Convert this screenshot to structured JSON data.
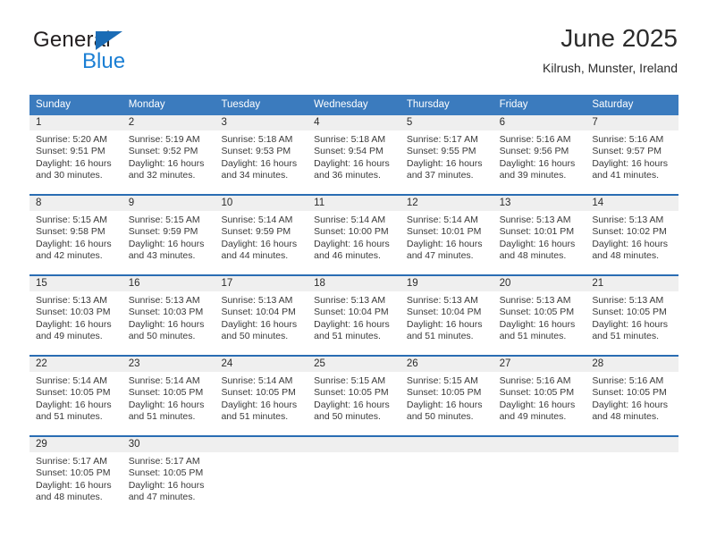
{
  "brand": {
    "name_part1": "General",
    "name_part2": "Blue",
    "accent_color": "#1b7fd4",
    "triangle_color": "#1b6cb5"
  },
  "header": {
    "title": "June 2025",
    "location": "Kilrush, Munster, Ireland"
  },
  "calendar": {
    "header_bg": "#3b7bbe",
    "header_text_color": "#ffffff",
    "row_divider_color": "#2a6db3",
    "day_band_bg": "#efefef",
    "weekdays": [
      "Sunday",
      "Monday",
      "Tuesday",
      "Wednesday",
      "Thursday",
      "Friday",
      "Saturday"
    ],
    "weeks": [
      [
        {
          "day": "1",
          "sunrise": "Sunrise: 5:20 AM",
          "sunset": "Sunset: 9:51 PM",
          "daylight": "Daylight: 16 hours and 30 minutes."
        },
        {
          "day": "2",
          "sunrise": "Sunrise: 5:19 AM",
          "sunset": "Sunset: 9:52 PM",
          "daylight": "Daylight: 16 hours and 32 minutes."
        },
        {
          "day": "3",
          "sunrise": "Sunrise: 5:18 AM",
          "sunset": "Sunset: 9:53 PM",
          "daylight": "Daylight: 16 hours and 34 minutes."
        },
        {
          "day": "4",
          "sunrise": "Sunrise: 5:18 AM",
          "sunset": "Sunset: 9:54 PM",
          "daylight": "Daylight: 16 hours and 36 minutes."
        },
        {
          "day": "5",
          "sunrise": "Sunrise: 5:17 AM",
          "sunset": "Sunset: 9:55 PM",
          "daylight": "Daylight: 16 hours and 37 minutes."
        },
        {
          "day": "6",
          "sunrise": "Sunrise: 5:16 AM",
          "sunset": "Sunset: 9:56 PM",
          "daylight": "Daylight: 16 hours and 39 minutes."
        },
        {
          "day": "7",
          "sunrise": "Sunrise: 5:16 AM",
          "sunset": "Sunset: 9:57 PM",
          "daylight": "Daylight: 16 hours and 41 minutes."
        }
      ],
      [
        {
          "day": "8",
          "sunrise": "Sunrise: 5:15 AM",
          "sunset": "Sunset: 9:58 PM",
          "daylight": "Daylight: 16 hours and 42 minutes."
        },
        {
          "day": "9",
          "sunrise": "Sunrise: 5:15 AM",
          "sunset": "Sunset: 9:59 PM",
          "daylight": "Daylight: 16 hours and 43 minutes."
        },
        {
          "day": "10",
          "sunrise": "Sunrise: 5:14 AM",
          "sunset": "Sunset: 9:59 PM",
          "daylight": "Daylight: 16 hours and 44 minutes."
        },
        {
          "day": "11",
          "sunrise": "Sunrise: 5:14 AM",
          "sunset": "Sunset: 10:00 PM",
          "daylight": "Daylight: 16 hours and 46 minutes."
        },
        {
          "day": "12",
          "sunrise": "Sunrise: 5:14 AM",
          "sunset": "Sunset: 10:01 PM",
          "daylight": "Daylight: 16 hours and 47 minutes."
        },
        {
          "day": "13",
          "sunrise": "Sunrise: 5:13 AM",
          "sunset": "Sunset: 10:01 PM",
          "daylight": "Daylight: 16 hours and 48 minutes."
        },
        {
          "day": "14",
          "sunrise": "Sunrise: 5:13 AM",
          "sunset": "Sunset: 10:02 PM",
          "daylight": "Daylight: 16 hours and 48 minutes."
        }
      ],
      [
        {
          "day": "15",
          "sunrise": "Sunrise: 5:13 AM",
          "sunset": "Sunset: 10:03 PM",
          "daylight": "Daylight: 16 hours and 49 minutes."
        },
        {
          "day": "16",
          "sunrise": "Sunrise: 5:13 AM",
          "sunset": "Sunset: 10:03 PM",
          "daylight": "Daylight: 16 hours and 50 minutes."
        },
        {
          "day": "17",
          "sunrise": "Sunrise: 5:13 AM",
          "sunset": "Sunset: 10:04 PM",
          "daylight": "Daylight: 16 hours and 50 minutes."
        },
        {
          "day": "18",
          "sunrise": "Sunrise: 5:13 AM",
          "sunset": "Sunset: 10:04 PM",
          "daylight": "Daylight: 16 hours and 51 minutes."
        },
        {
          "day": "19",
          "sunrise": "Sunrise: 5:13 AM",
          "sunset": "Sunset: 10:04 PM",
          "daylight": "Daylight: 16 hours and 51 minutes."
        },
        {
          "day": "20",
          "sunrise": "Sunrise: 5:13 AM",
          "sunset": "Sunset: 10:05 PM",
          "daylight": "Daylight: 16 hours and 51 minutes."
        },
        {
          "day": "21",
          "sunrise": "Sunrise: 5:13 AM",
          "sunset": "Sunset: 10:05 PM",
          "daylight": "Daylight: 16 hours and 51 minutes."
        }
      ],
      [
        {
          "day": "22",
          "sunrise": "Sunrise: 5:14 AM",
          "sunset": "Sunset: 10:05 PM",
          "daylight": "Daylight: 16 hours and 51 minutes."
        },
        {
          "day": "23",
          "sunrise": "Sunrise: 5:14 AM",
          "sunset": "Sunset: 10:05 PM",
          "daylight": "Daylight: 16 hours and 51 minutes."
        },
        {
          "day": "24",
          "sunrise": "Sunrise: 5:14 AM",
          "sunset": "Sunset: 10:05 PM",
          "daylight": "Daylight: 16 hours and 51 minutes."
        },
        {
          "day": "25",
          "sunrise": "Sunrise: 5:15 AM",
          "sunset": "Sunset: 10:05 PM",
          "daylight": "Daylight: 16 hours and 50 minutes."
        },
        {
          "day": "26",
          "sunrise": "Sunrise: 5:15 AM",
          "sunset": "Sunset: 10:05 PM",
          "daylight": "Daylight: 16 hours and 50 minutes."
        },
        {
          "day": "27",
          "sunrise": "Sunrise: 5:16 AM",
          "sunset": "Sunset: 10:05 PM",
          "daylight": "Daylight: 16 hours and 49 minutes."
        },
        {
          "day": "28",
          "sunrise": "Sunrise: 5:16 AM",
          "sunset": "Sunset: 10:05 PM",
          "daylight": "Daylight: 16 hours and 48 minutes."
        }
      ],
      [
        {
          "day": "29",
          "sunrise": "Sunrise: 5:17 AM",
          "sunset": "Sunset: 10:05 PM",
          "daylight": "Daylight: 16 hours and 48 minutes."
        },
        {
          "day": "30",
          "sunrise": "Sunrise: 5:17 AM",
          "sunset": "Sunset: 10:05 PM",
          "daylight": "Daylight: 16 hours and 47 minutes."
        },
        {
          "day": "",
          "sunrise": "",
          "sunset": "",
          "daylight": ""
        },
        {
          "day": "",
          "sunrise": "",
          "sunset": "",
          "daylight": ""
        },
        {
          "day": "",
          "sunrise": "",
          "sunset": "",
          "daylight": ""
        },
        {
          "day": "",
          "sunrise": "",
          "sunset": "",
          "daylight": ""
        },
        {
          "day": "",
          "sunrise": "",
          "sunset": "",
          "daylight": ""
        }
      ]
    ]
  }
}
